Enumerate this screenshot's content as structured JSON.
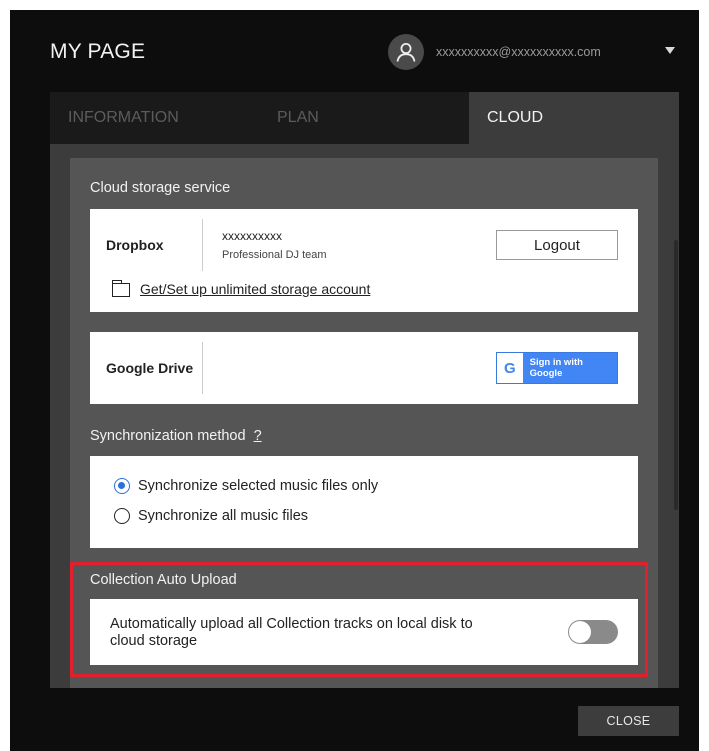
{
  "window": {
    "title": "MY PAGE"
  },
  "account": {
    "email": "xxxxxxxxxx@xxxxxxxxxx.com"
  },
  "tabs": [
    {
      "label": "INFORMATION",
      "active": false
    },
    {
      "label": "PLAN",
      "active": false
    },
    {
      "label": "CLOUD",
      "active": true
    }
  ],
  "cloud_storage": {
    "label": "Cloud storage service",
    "dropbox": {
      "name": "Dropbox",
      "account_name": "xxxxxxxxxx",
      "team": "Professional DJ team",
      "logout_label": "Logout",
      "storage_link": "Get/Set up unlimited storage account"
    },
    "google_drive": {
      "name": "Google Drive",
      "google_letter": "G",
      "sign_in_label": "Sign in with Google"
    }
  },
  "sync": {
    "label": "Synchronization method",
    "help": "?",
    "options": [
      {
        "label": "Synchronize selected music files only",
        "selected": true
      },
      {
        "label": "Synchronize all music files",
        "selected": false
      }
    ]
  },
  "auto_upload": {
    "label": "Collection Auto Upload",
    "description": "Automatically upload all Collection tracks on local disk to cloud storage",
    "enabled": false
  },
  "footer": {
    "close_label": "CLOSE"
  },
  "colors": {
    "background": "#0d0d0d",
    "panel": "#3c3c3c",
    "section": "#555555",
    "google_blue": "#4285f4",
    "radio_accent": "#2b6fd8",
    "highlight_red": "#e0202c",
    "toggle_off": "#8a8a8a"
  }
}
